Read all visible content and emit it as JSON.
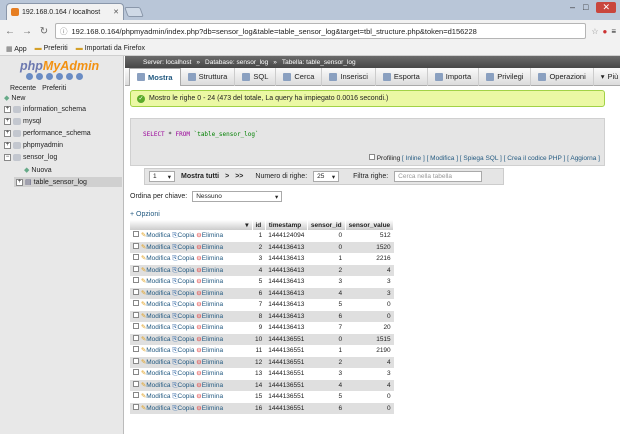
{
  "browser": {
    "tab_title": "192.168.0.164 / localhost",
    "url": "192.168.0.164/phpmyadmin/index.php?db=sensor_log&table=table_sensor_log&target=tbl_structure.php&token=d156228",
    "bookmarks": [
      "App",
      "Preferiti",
      "Importati da Firefox"
    ]
  },
  "sidebar": {
    "logo_php": "php",
    "logo_my": "MyAdmin",
    "tabs": [
      "Recente",
      "Preferiti"
    ],
    "tree": [
      {
        "label": "New",
        "sign": ""
      },
      {
        "label": "information_schema",
        "sign": "+"
      },
      {
        "label": "mysql",
        "sign": "+"
      },
      {
        "label": "performance_schema",
        "sign": "+"
      },
      {
        "label": "phpmyadmin",
        "sign": "+"
      },
      {
        "label": "sensor_log",
        "sign": "−"
      },
      {
        "label": "Nuova",
        "sign": ""
      },
      {
        "label": "table_sensor_log",
        "sign": "+"
      }
    ]
  },
  "breadcrumb": {
    "server": "Server: localhost",
    "database": "Database: sensor_log",
    "table": "Tabella: table_sensor_log"
  },
  "tabs": [
    "Mostra",
    "Struttura",
    "SQL",
    "Cerca",
    "Inserisci",
    "Esporta",
    "Importa",
    "Privilegi",
    "Operazioni",
    "Più"
  ],
  "message": "Mostro le righe 0 - 24 (473 del totale, La query ha impiegato 0.0016 secondi.)",
  "sql": {
    "select": "SELECT",
    "star": " * ",
    "from": "FROM",
    "table": " `table_sensor_log`"
  },
  "sql_links": {
    "profiling": "Profiling",
    "links": "[ Inline ] [ Modifica ] [ Spiega SQL ] [ Crea il codice PHP ] [ Aggiorna ]"
  },
  "nav": {
    "page": "1",
    "show_all": "Mostra tutti",
    "next": ">",
    "last": ">>",
    "rows_label": "Numero di righe:",
    "rows_value": "25",
    "filter_label": "Filtra righe:",
    "filter_placeholder": "Cerca nella tabella"
  },
  "sort": {
    "label": "Ordina per chiave:",
    "value": "Nessuno"
  },
  "options_label": "+ Opzioni",
  "columns": [
    "id",
    "timestamp",
    "sensor_id",
    "sensor_value"
  ],
  "actions": {
    "edit": "Modifica",
    "copy": "Copia",
    "delete": "Elimina"
  },
  "rows": [
    [
      "1",
      "1444124094",
      "0",
      "512"
    ],
    [
      "2",
      "1444136413",
      "0",
      "1520"
    ],
    [
      "3",
      "1444136413",
      "1",
      "2216"
    ],
    [
      "4",
      "1444136413",
      "2",
      "4"
    ],
    [
      "5",
      "1444136413",
      "3",
      "3"
    ],
    [
      "6",
      "1444136413",
      "4",
      "3"
    ],
    [
      "7",
      "1444136413",
      "5",
      "0"
    ],
    [
      "8",
      "1444136413",
      "6",
      "0"
    ],
    [
      "9",
      "1444136413",
      "7",
      "20"
    ],
    [
      "10",
      "1444136551",
      "0",
      "1515"
    ],
    [
      "11",
      "1444136551",
      "1",
      "2190"
    ],
    [
      "12",
      "1444136551",
      "2",
      "4"
    ],
    [
      "13",
      "1444136551",
      "3",
      "3"
    ],
    [
      "14",
      "1444136551",
      "4",
      "4"
    ],
    [
      "15",
      "1444136551",
      "5",
      "0"
    ],
    [
      "16",
      "1444136551",
      "6",
      "0"
    ]
  ]
}
